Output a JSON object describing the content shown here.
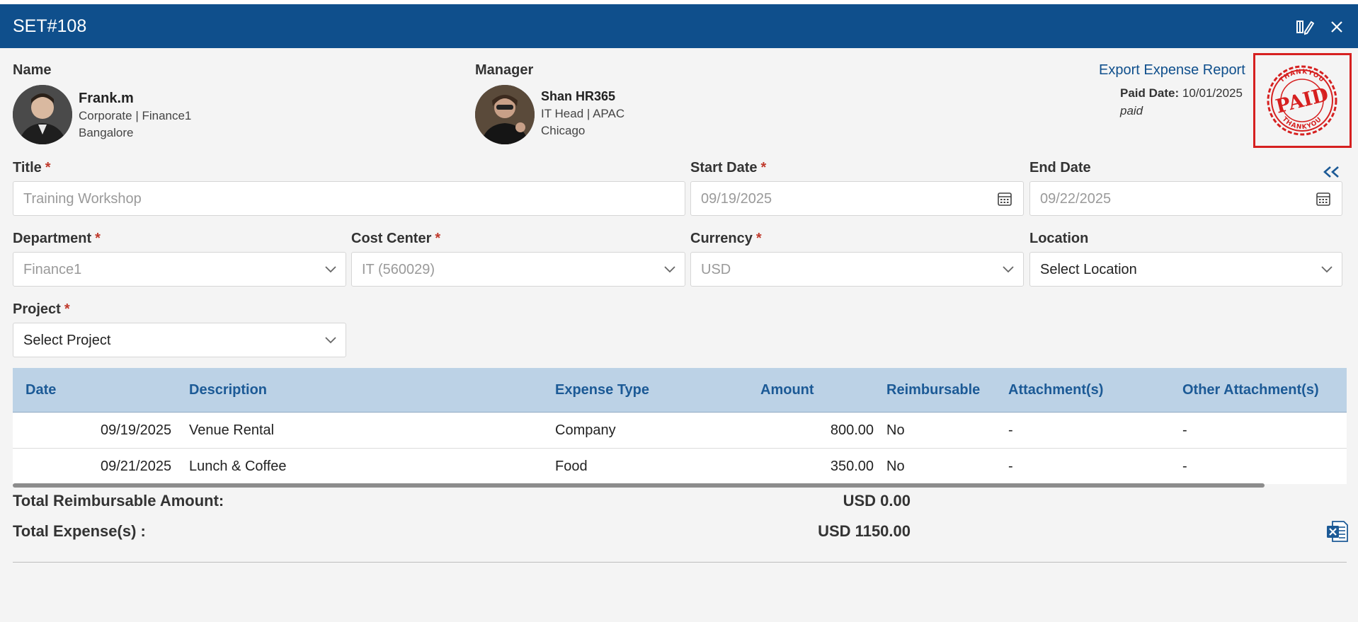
{
  "header": {
    "title": "SET#108",
    "actions": [
      {
        "name": "approval-history",
        "icon": "document-sign-icon"
      },
      {
        "name": "close",
        "icon": "close-icon"
      }
    ]
  },
  "employee": {
    "label": "Name",
    "name": "Frank.m",
    "role": "Corporate | Finance1",
    "city": "Bangalore"
  },
  "manager": {
    "label": "Manager",
    "name": "Shan HR365",
    "role": "IT Head | APAC",
    "city": "Chicago"
  },
  "export_link": "Export Expense Report",
  "paid": {
    "date_label": "Paid Date:",
    "date": "10/01/2025",
    "status": "paid",
    "stamp_text": "PAID",
    "stamp_ring": "THANKYOU",
    "stamp_color": "#d62020"
  },
  "form": {
    "title": {
      "label": "Title",
      "value": "Training Workshop",
      "required": "*"
    },
    "start_date": {
      "label": "Start Date",
      "value": "09/19/2025",
      "required": "*"
    },
    "end_date": {
      "label": "End Date",
      "value": "09/22/2025"
    },
    "department": {
      "label": "Department",
      "value": "Finance1",
      "required": "*"
    },
    "cost_center": {
      "label": "Cost Center",
      "value": "IT (560029)",
      "required": "*"
    },
    "currency": {
      "label": "Currency",
      "value": "USD",
      "required": "*"
    },
    "location": {
      "label": "Location",
      "value": "Select Location"
    },
    "project": {
      "label": "Project",
      "value": "Select Project",
      "required": "*"
    }
  },
  "table": {
    "columns": [
      "Date",
      "Description",
      "Expense Type",
      "Amount",
      "Reimbursable",
      "Attachment(s)",
      "Other Attachment(s)"
    ],
    "rows": [
      {
        "date": "09/19/2025",
        "description": "Venue Rental",
        "type": "Company",
        "amount": "800.00",
        "reimbursable": "No",
        "attachments": "-",
        "other": "-"
      },
      {
        "date": "09/21/2025",
        "description": "Lunch & Coffee",
        "type": "Food",
        "amount": "350.00",
        "reimbursable": "No",
        "attachments": "-",
        "other": "-"
      }
    ]
  },
  "totals": {
    "reimbursable_label": "Total Reimbursable Amount:",
    "reimbursable_value": "USD 0.00",
    "expense_label": "Total Expense(s) :",
    "expense_value": "USD 1150.00"
  },
  "colors": {
    "header_bg": "#0f4f8c",
    "table_header_bg": "#bcd2e6",
    "link": "#0f4f8c",
    "required": "#c0392b"
  }
}
